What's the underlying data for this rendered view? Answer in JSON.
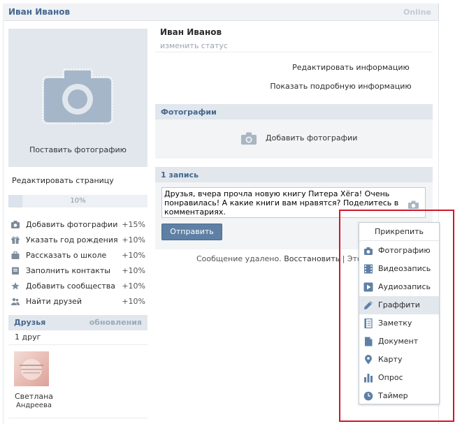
{
  "top_bar": {
    "name": "Иван Иванов",
    "online": "Online"
  },
  "profile": {
    "name": "Иван Иванов",
    "status_placeholder": "изменить статус",
    "edit_info": "Редактировать информацию",
    "show_more": "Показать подробную информацию"
  },
  "avatar": {
    "upload_label": "Поставить фотографию"
  },
  "edit_page": "Редактировать страницу",
  "progress": {
    "value": 0.1,
    "label": "10%"
  },
  "bonuses": [
    {
      "icon": "camera-icon",
      "label": "Добавить фотографии",
      "pct": "+15%"
    },
    {
      "icon": "gift-icon",
      "label": "Указать год рождения",
      "pct": "+10%"
    },
    {
      "icon": "briefcase-icon",
      "label": "Рассказать о школе",
      "pct": "+10%"
    },
    {
      "icon": "contacts-icon",
      "label": "Заполнить контакты",
      "pct": "+10%"
    },
    {
      "icon": "star-icon",
      "label": "Добавить сообщества",
      "pct": "+10%"
    },
    {
      "icon": "people-icon",
      "label": "Найти друзей",
      "pct": "+10%"
    }
  ],
  "friends": {
    "title": "Друзья",
    "updates": "обновления",
    "count": "1 друг",
    "items": [
      {
        "first": "Светлана",
        "last": "Андреева"
      }
    ]
  },
  "photos": {
    "title": "Фотографии",
    "add": "Добавить фотографии"
  },
  "wall": {
    "title": "1 запись",
    "text": "Друзья, вчера прочла новую книгу Питера Хёга! Очень понравилась! А какие книги вам нравятся? Поделитесь в комментариях.",
    "send": "Отправить",
    "deleted_prefix": "Сообщение удалено.",
    "restore": "Восстановить",
    "deleted_suffix": "| Это спа"
  },
  "attach_menu": {
    "title": "Прикрепить",
    "items": [
      {
        "icon": "photo-icon",
        "label": "Фотографию"
      },
      {
        "icon": "video-icon",
        "label": "Видеозапись"
      },
      {
        "icon": "audio-icon",
        "label": "Аудиозапись"
      },
      {
        "icon": "pencil-icon",
        "label": "Граффити",
        "highlighted": true
      },
      {
        "icon": "note-icon",
        "label": "Заметку"
      },
      {
        "icon": "document-icon",
        "label": "Документ"
      },
      {
        "icon": "map-pin-icon",
        "label": "Карту"
      },
      {
        "icon": "poll-icon",
        "label": "Опрос"
      },
      {
        "icon": "clock-icon",
        "label": "Таймер"
      }
    ]
  },
  "colors": {
    "link": "#45688e",
    "button": "#5e80a5",
    "highlight_box": "#d0162a",
    "panel": "#e1e7ed"
  }
}
